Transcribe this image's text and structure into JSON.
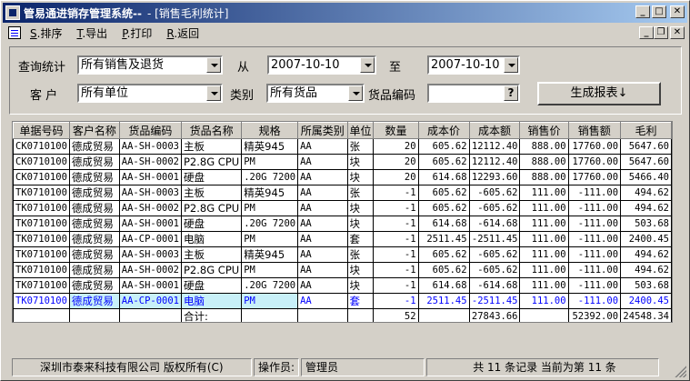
{
  "window": {
    "title": "管易通进销存管理系统--",
    "subtitle": "- [销售毛利统计]"
  },
  "toolbar": {
    "items": [
      {
        "key": "S",
        "label": ".排序"
      },
      {
        "key": "T",
        "label": ".导出"
      },
      {
        "key": "P",
        "label": ".打印"
      },
      {
        "key": "R",
        "label": ".返回"
      }
    ]
  },
  "query": {
    "stat_label": "查询统计",
    "stat_value": "所有销售及退货",
    "from_label": "从",
    "from_date": "2007-10-10",
    "to_label": "至",
    "to_date": "2007-10-10",
    "customer_label": "客  户",
    "customer_value": "所有单位",
    "category_label": "类别",
    "category_value": "所有货品",
    "code_label": "货品编码",
    "code_value": "",
    "code_button": "?",
    "generate_button": "生成报表↓"
  },
  "grid": {
    "columns": [
      "单据号码",
      "客户名称",
      "货品编码",
      "货品名称",
      "规格",
      "所属类别",
      "单位",
      "数量",
      "成本价",
      "成本额",
      "销售价",
      "销售额",
      "毛利"
    ],
    "rows": [
      [
        "CK0710100",
        "德成贸易",
        "AA-SH-0003",
        "主板",
        "精英945",
        "AA",
        "张",
        "20",
        "605.62",
        "12112.40",
        "888.00",
        "17760.00",
        "5647.60"
      ],
      [
        "CK0710100",
        "德成贸易",
        "AA-SH-0002",
        "P2.8G CPU",
        "PM",
        "AA",
        "块",
        "20",
        "605.62",
        "12112.40",
        "888.00",
        "17760.00",
        "5647.60"
      ],
      [
        "CK0710100",
        "德成贸易",
        "AA-SH-0001",
        "硬盘",
        ".20G 7200",
        "AA",
        "块",
        "20",
        "614.68",
        "12293.60",
        "888.00",
        "17760.00",
        "5466.40"
      ],
      [
        "TK0710100",
        "德成贸易",
        "AA-SH-0003",
        "主板",
        "精英945",
        "AA",
        "张",
        "-1",
        "605.62",
        "-605.62",
        "111.00",
        "-111.00",
        "494.62"
      ],
      [
        "TK0710100",
        "德成贸易",
        "AA-SH-0002",
        "P2.8G CPU",
        "PM",
        "AA",
        "块",
        "-1",
        "605.62",
        "-605.62",
        "111.00",
        "-111.00",
        "494.62"
      ],
      [
        "TK0710100",
        "德成贸易",
        "AA-SH-0001",
        "硬盘",
        ".20G 7200",
        "AA",
        "块",
        "-1",
        "614.68",
        "-614.68",
        "111.00",
        "-111.00",
        "503.68"
      ],
      [
        "TK0710100",
        "德成贸易",
        "AA-CP-0001",
        "电脑",
        "PM",
        "AA",
        "套",
        "-1",
        "2511.45",
        "-2511.45",
        "111.00",
        "-111.00",
        "2400.45"
      ],
      [
        "TK0710100",
        "德成贸易",
        "AA-SH-0003",
        "主板",
        "精英945",
        "AA",
        "张",
        "-1",
        "605.62",
        "-605.62",
        "111.00",
        "-111.00",
        "494.62"
      ],
      [
        "TK0710100",
        "德成贸易",
        "AA-SH-0002",
        "P2.8G CPU",
        "PM",
        "AA",
        "块",
        "-1",
        "605.62",
        "-605.62",
        "111.00",
        "-111.00",
        "494.62"
      ],
      [
        "TK0710100",
        "德成贸易",
        "AA-SH-0001",
        "硬盘",
        ".20G 7200",
        "AA",
        "块",
        "-1",
        "614.68",
        "-614.68",
        "111.00",
        "-111.00",
        "503.68"
      ],
      [
        "TK0710100",
        "德成贸易",
        "AA-CP-0001",
        "电脑",
        "PM",
        "AA",
        "套",
        "-1",
        "2511.45",
        "-2511.45",
        "111.00",
        "-111.00",
        "2400.45"
      ]
    ],
    "total_row": [
      "",
      "",
      "",
      "合计:",
      "",
      "",
      "",
      "52",
      "",
      "27843.66",
      "",
      "52392.00",
      "24548.34"
    ]
  },
  "status": {
    "copyright": "深圳市泰来科技有限公司 版权所有(C)",
    "operator_label": "操作员:",
    "operator": "管理员",
    "records": "共 11 条记录 当前为第 11 条"
  }
}
